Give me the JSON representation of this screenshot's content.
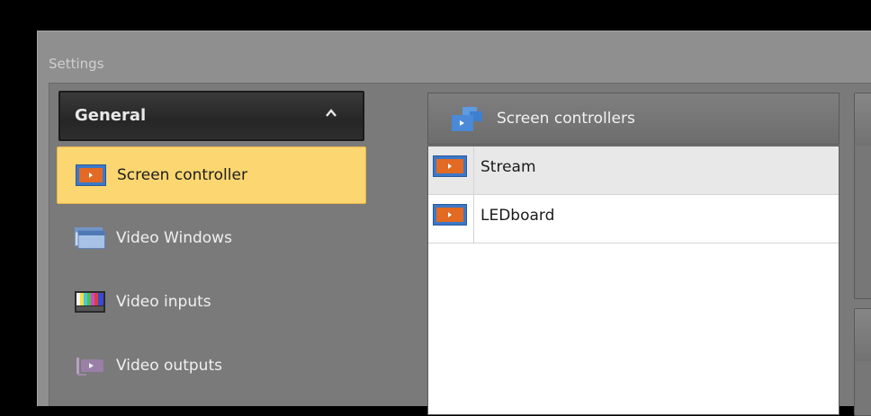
{
  "window": {
    "title": "Settings"
  },
  "nav": {
    "group_label": "General",
    "items": [
      {
        "label": "Screen controller",
        "icon": "screen-controller-icon",
        "selected": true
      },
      {
        "label": "Video Windows",
        "icon": "video-windows-icon",
        "selected": false
      },
      {
        "label": "Video inputs",
        "icon": "video-inputs-icon",
        "selected": false
      },
      {
        "label": "Video outputs",
        "icon": "video-outputs-icon",
        "selected": false
      }
    ]
  },
  "controllers": {
    "header": "Screen controllers",
    "rows": [
      {
        "label": "Stream",
        "icon": "screen-controller-icon",
        "selected": true
      },
      {
        "label": "LEDboard",
        "icon": "screen-controller-icon",
        "selected": false
      }
    ]
  },
  "colors": {
    "selection": "#fbd671",
    "accent_orange": "#e36a22",
    "accent_blue": "#3c78c8"
  }
}
